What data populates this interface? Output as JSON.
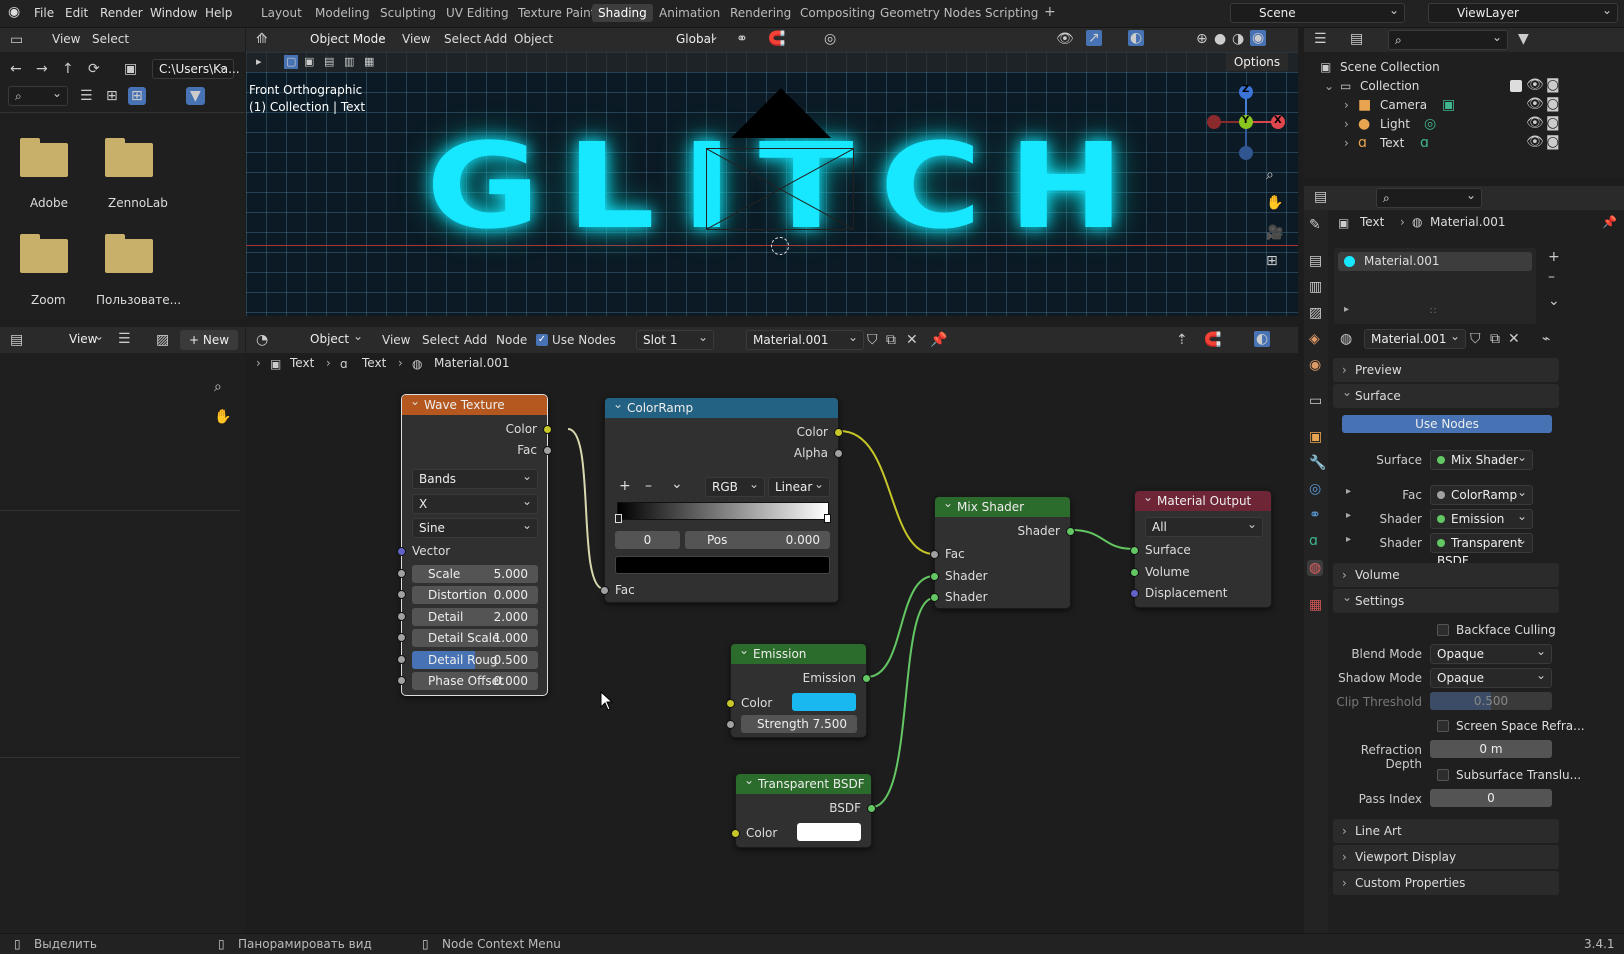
{
  "topbar": {
    "menus": [
      "File",
      "Edit",
      "Render",
      "Window",
      "Help"
    ],
    "workspaces": [
      "Layout",
      "Modeling",
      "Sculpting",
      "UV Editing",
      "Texture Paint",
      "Shading",
      "Animation",
      "Rendering",
      "Compositing",
      "Geometry Nodes",
      "Scripting"
    ],
    "active_workspace": "Shading",
    "scene": "Scene",
    "view_layer": "ViewLayer"
  },
  "file_browser": {
    "menus": [
      "View",
      "Select"
    ],
    "path": "C:\\Users\\Ka...",
    "folders": [
      "Adobe",
      "ZennoLab",
      "Zoom",
      "Пользовате..."
    ]
  },
  "image_editor": {
    "view": "View",
    "new_label": "New"
  },
  "viewport": {
    "mode": "Object Mode",
    "menus": [
      "View",
      "Select",
      "Add",
      "Object"
    ],
    "orientation": "Global",
    "options": "Options",
    "overlay_title": "Front Orthographic",
    "overlay_sub": "(1) Collection | Text",
    "text_object": "GLITCH",
    "gizmo": {
      "z": "Z",
      "y": "Y",
      "x": "X"
    }
  },
  "outliner": {
    "scene_collection": "Scene Collection",
    "collection": "Collection",
    "items": [
      "Camera",
      "Light",
      "Text"
    ]
  },
  "node_editor": {
    "object_dd": "Object",
    "menus": [
      "View",
      "Select",
      "Add",
      "Node"
    ],
    "use_nodes": "Use Nodes",
    "slot": "Slot 1",
    "material": "Material.001",
    "breadcrumb": [
      "Text",
      "Text",
      "Material.001"
    ]
  },
  "nodes": {
    "wave": {
      "title": "Wave Texture",
      "out_color": "Color",
      "out_fac": "Fac",
      "type": "Bands",
      "direction": "X",
      "profile": "Sine",
      "vector": "Vector",
      "fields": [
        {
          "label": "Scale",
          "value": "5.000"
        },
        {
          "label": "Distortion",
          "value": "0.000"
        },
        {
          "label": "Detail",
          "value": "2.000"
        },
        {
          "label": "Detail Scale",
          "value": "1.000"
        },
        {
          "label": "Detail Roug",
          "value": "0.500"
        },
        {
          "label": "Phase Offset",
          "value": "0.000"
        }
      ]
    },
    "ramp": {
      "title": "ColorRamp",
      "out_color": "Color",
      "out_alpha": "Alpha",
      "mode": "RGB",
      "interp": "Linear",
      "index": "0",
      "pos_label": "Pos",
      "pos_value": "0.000",
      "in_fac": "Fac",
      "plus": "+",
      "minus": "–"
    },
    "mix": {
      "title": "Mix Shader",
      "out": "Shader",
      "in_fac": "Fac",
      "in_s1": "Shader",
      "in_s2": "Shader"
    },
    "output": {
      "title": "Material Output",
      "target": "All",
      "surface": "Surface",
      "volume": "Volume",
      "displacement": "Displacement"
    },
    "emission": {
      "title": "Emission",
      "out": "Emission",
      "color": "Color",
      "strength_label": "Strength",
      "strength_value": "7.500",
      "color_hex": "#1ab8f0"
    },
    "transparent": {
      "title": "Transparent BSDF",
      "out": "BSDF",
      "color": "Color"
    }
  },
  "properties": {
    "crumb_object": "Text",
    "crumb_material": "Material.001",
    "slot_name": "Material.001",
    "material": "Material.001",
    "sections": {
      "preview": "Preview",
      "surface": "Surface",
      "volume": "Volume",
      "settings": "Settings",
      "line_art": "Line Art",
      "viewport_display": "Viewport Display",
      "custom_props": "Custom Properties"
    },
    "use_nodes": "Use Nodes",
    "surface_rows": [
      {
        "label": "Surface",
        "value": "Mix Shader"
      },
      {
        "label": "Fac",
        "value": "ColorRamp"
      },
      {
        "label": "Shader",
        "value": "Emission"
      },
      {
        "label": "Shader",
        "value": "Transparent BSDF"
      }
    ],
    "settings": {
      "backface": "Backface Culling",
      "blend_label": "Blend Mode",
      "blend_value": "Opaque",
      "shadow_label": "Shadow Mode",
      "shadow_value": "Opaque",
      "clip_label": "Clip Threshold",
      "clip_value": "0.500",
      "ssr": "Screen Space Refra...",
      "refr_label": "Refraction Depth",
      "refr_value": "0 m",
      "sss": "Subsurface Translu...",
      "pass_label": "Pass Index",
      "pass_value": "0"
    }
  },
  "status": {
    "left": "Выделить",
    "mid": "Панорамировать вид",
    "right": "Node Context Menu",
    "version": "3.4.1"
  },
  "colors": {
    "accent": "#4772b3",
    "cyan_glow": "#17e8ff",
    "emission": "#1ab8f0"
  }
}
